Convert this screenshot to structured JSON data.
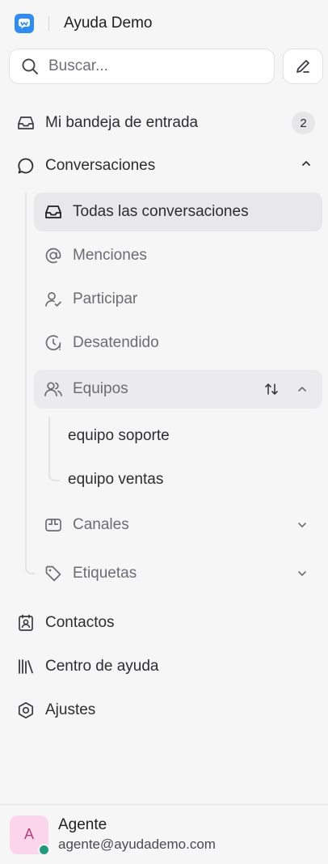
{
  "app": {
    "title": "Ayuda Demo"
  },
  "search": {
    "placeholder": "Buscar..."
  },
  "nav": {
    "inbox": {
      "label": "Mi bandeja de entrada",
      "count": "2"
    },
    "conversations": {
      "label": "Conversaciones"
    },
    "sub": {
      "all": "Todas las conversaciones",
      "mentions": "Menciones",
      "participate": "Participar",
      "unattended": "Desatendido",
      "teams": "Equipos",
      "channels": "Canales",
      "labels": "Etiquetas"
    },
    "teams": [
      "equipo soporte",
      "equipo ventas"
    ],
    "contacts": "Contactos",
    "help_center": "Centro de ayuda",
    "settings": "Ajustes"
  },
  "user": {
    "initial": "A",
    "name": "Agente",
    "email": "agente@ayudademo.com",
    "status_color": "#1f9b7c"
  }
}
